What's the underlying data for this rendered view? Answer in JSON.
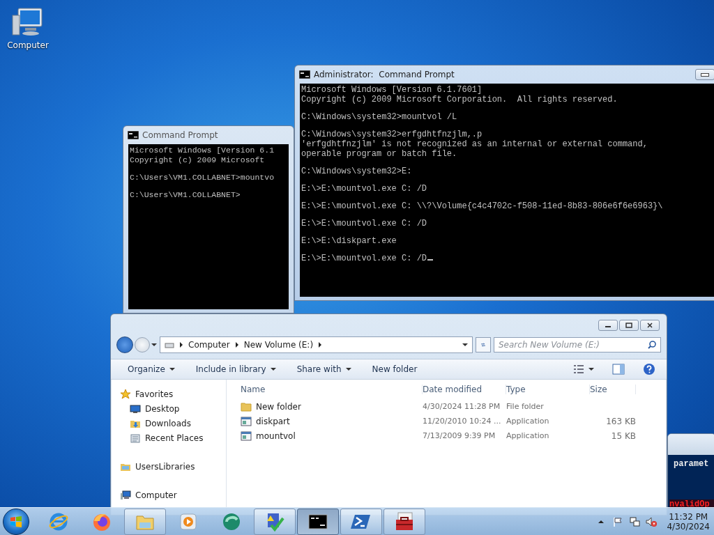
{
  "desktop_icons": [
    {
      "kind": "computer",
      "label": "Computer"
    }
  ],
  "windows": [
    {
      "kind": "powershell",
      "lines": [
        {
          "kind": "output",
          "text": "paramet"
        },
        {
          "kind": "error",
          "text": "nvalidOp"
        }
      ]
    },
    {
      "kind": "console",
      "title": "Command Prompt",
      "active": false,
      "blocks": [
        [
          "Microsoft Windows [Version 6.1",
          "Copyright (c) 2009 Microsoft"
        ],
        [
          "C:\\Users\\VM1.COLLABNET>mountvo"
        ],
        [
          "C:\\Users\\VM1.COLLABNET>"
        ]
      ]
    },
    {
      "kind": "console",
      "title": "Administrator:  Command Prompt",
      "active": true,
      "cursor": true,
      "blocks": [
        [
          "Microsoft Windows [Version 6.1.7601]",
          "Copyright (c) 2009 Microsoft Corporation.  All rights reserved."
        ],
        [
          "C:\\Windows\\system32>mountvol /L"
        ],
        [
          "C:\\Windows\\system32>erfgdhtfnzjlm,.p",
          "'erfgdhtfnzjlm' is not recognized as an internal or external command,",
          "operable program or batch file."
        ],
        [
          "C:\\Windows\\system32>E:"
        ],
        [
          "E:\\>E:\\mountvol.exe C: /D"
        ],
        [
          "E:\\>E:\\mountvol.exe C: \\\\?\\Volume{c4c4702c-f508-11ed-8b83-806e6f6e6963}\\"
        ],
        [
          "E:\\>E:\\mountvol.exe C: /D"
        ],
        [
          "E:\\>E:\\diskpart.exe"
        ],
        [
          "E:\\>E:\\mountvol.exe C: /D"
        ]
      ]
    },
    {
      "kind": "explorer",
      "breadcrumb": [
        "Computer",
        "New Volume (E:)"
      ],
      "search": {
        "placeholder": "Search New Volume (E:)"
      },
      "toolbar": [
        {
          "label": "Organize",
          "dropdown": true
        },
        {
          "label": "Include in library",
          "dropdown": true
        },
        {
          "label": "Share with",
          "dropdown": true
        },
        {
          "label": "New folder",
          "dropdown": false
        }
      ],
      "nav": [
        {
          "kind": "favorites",
          "label": "Favorites",
          "children": [
            {
              "kind": "desktop",
              "label": "Desktop"
            },
            {
              "kind": "downloads",
              "label": "Downloads"
            },
            {
              "kind": "recent",
              "label": "Recent Places"
            }
          ]
        },
        {
          "kind": "libraries",
          "label": "UsersLibraries"
        },
        {
          "kind": "computer",
          "label": "Computer"
        }
      ],
      "columns": [
        "Name",
        "Date modified",
        "Type",
        "Size"
      ],
      "rows": [
        {
          "kind": "folder",
          "name": "New folder",
          "date": "4/30/2024 11:28 PM",
          "type": "File folder"
        },
        {
          "kind": "app",
          "name": "diskpart",
          "date": "11/20/2010 10:24 ...",
          "type": "Application",
          "size": "163 KB"
        },
        {
          "kind": "app",
          "name": "mountvol",
          "date": "7/13/2009 9:39 PM",
          "type": "Application",
          "size": "15 KB"
        }
      ]
    }
  ],
  "taskbar": {
    "items": [
      {
        "kind": "ie",
        "running": false,
        "active": false
      },
      {
        "kind": "firefox",
        "running": false,
        "active": false
      },
      {
        "kind": "explorer",
        "running": true,
        "active": false
      },
      {
        "kind": "media",
        "running": false,
        "active": false
      },
      {
        "kind": "orb",
        "running": false,
        "active": false
      },
      {
        "kind": "checklist",
        "running": true,
        "active": false
      },
      {
        "kind": "cmd",
        "running": true,
        "active": true
      },
      {
        "kind": "powershell",
        "running": true,
        "active": false
      },
      {
        "kind": "toolbox",
        "running": true,
        "active": false
      }
    ],
    "tray": {
      "time": "11:32 PM",
      "date": "4/30/2024"
    }
  }
}
